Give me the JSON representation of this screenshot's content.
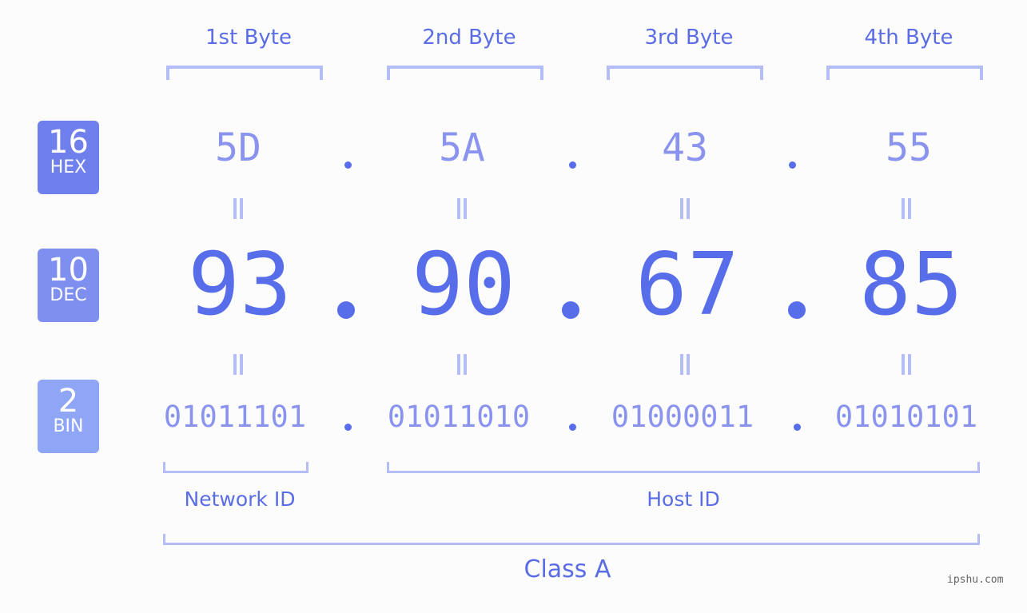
{
  "ip": {
    "decimal": "93.90.67.85",
    "class": "Class A"
  },
  "byte_headers": [
    "1st Byte",
    "2nd Byte",
    "3rd Byte",
    "4th Byte"
  ],
  "badges": {
    "hex": {
      "num": "16",
      "label": "HEX",
      "color": "#6f80ec"
    },
    "dec": {
      "num": "10",
      "label": "DEC",
      "color": "#7f8ff0"
    },
    "bin": {
      "num": "2",
      "label": "BIN",
      "color": "#8fa5f6"
    }
  },
  "rows": {
    "hex": [
      "5D",
      "5A",
      "43",
      "55"
    ],
    "dec": [
      "93",
      "90",
      "67",
      "85"
    ],
    "bin": [
      "01011101",
      "01011010",
      "01000011",
      "01010101"
    ]
  },
  "separator": ".",
  "equals": "=",
  "segments": {
    "network": "Network ID",
    "host": "Host ID"
  },
  "class_label": "Class A",
  "watermark": "ipshu.com",
  "colors": {
    "primary": "#586de9",
    "light": "#8a94ee",
    "bracket": "#b4bdf7"
  }
}
